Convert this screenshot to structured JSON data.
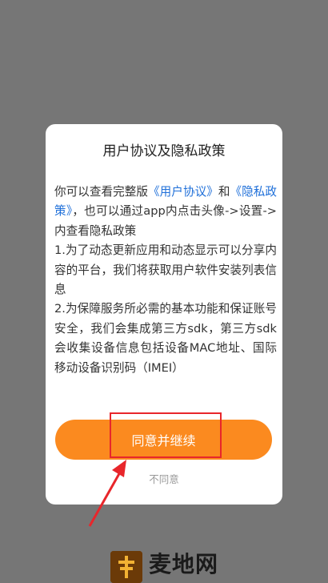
{
  "brand": {
    "name": "麦地网",
    "logo_icon": "brand-logo-icon"
  },
  "dialog": {
    "title": "用户协议及隐私政策",
    "body": {
      "intro_prefix": "你可以查看完整版",
      "user_agreement_link": "《用户协议》",
      "intro_and": "和",
      "privacy_policy_link": "《隐私政策》",
      "intro_suffix": "，也可以通过app内点击头像->设置->内查看隐私政策",
      "item1": "1.为了动态更新应用和动态显示可以分享内容的平台，我们将获取用户软件安装列表信息",
      "item2": "2.为保障服务所必需的基本功能和保证账号安全，我们会集成第三方sdk，第三方sdk会收集设备信息包括设备MAC地址、国际移动设备识别码（IMEI）"
    },
    "agree_button": "同意并继续",
    "disagree_link": "不同意"
  },
  "colors": {
    "accent": "#fb8a1f",
    "link": "#1e6fd9",
    "annotation": "#e8262b",
    "overlay": "#767676"
  }
}
